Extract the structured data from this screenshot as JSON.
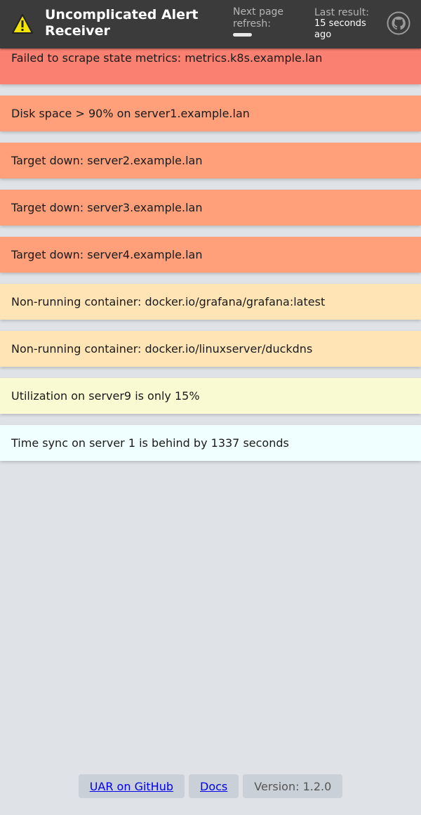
{
  "header": {
    "title": "Uncomplicated Alert Receiver",
    "refresh_label": "Next page refresh:",
    "refresh_progress": 0.25,
    "last_result_label": "Last result:",
    "last_result_value": "15 seconds ago",
    "logo_icon": "warning-icon",
    "github_icon": "github-icon"
  },
  "alerts": [
    {
      "text": "Failed to scrape state metrics: metrics.k8s.example.lan",
      "severity": "critical",
      "color": "#fa8072"
    },
    {
      "text": "Disk space > 90% on server1.example.lan",
      "severity": "error",
      "color": "#ffa07a"
    },
    {
      "text": "Target down: server2.example.lan",
      "severity": "error",
      "color": "#ffa07a"
    },
    {
      "text": "Target down: server3.example.lan",
      "severity": "error",
      "color": "#ffa07a"
    },
    {
      "text": "Target down: server4.example.lan",
      "severity": "error",
      "color": "#ffa07a"
    },
    {
      "text": "Non-running container: docker.io/grafana/grafana:latest",
      "severity": "warning",
      "color": "#ffe4b5"
    },
    {
      "text": "Non-running container: docker.io/linuxserver/duckdns",
      "severity": "warning",
      "color": "#ffe4b5"
    },
    {
      "text": "Utilization on server9 is only 15%",
      "severity": "info",
      "color": "#fafad2"
    },
    {
      "text": "Time sync on server 1 is behind by 1337 seconds",
      "severity": "debug",
      "color": "#f0ffff"
    }
  ],
  "footer": {
    "github_link": "UAR on GitHub",
    "docs_link": "Docs",
    "version": "Version: 1.2.0"
  }
}
